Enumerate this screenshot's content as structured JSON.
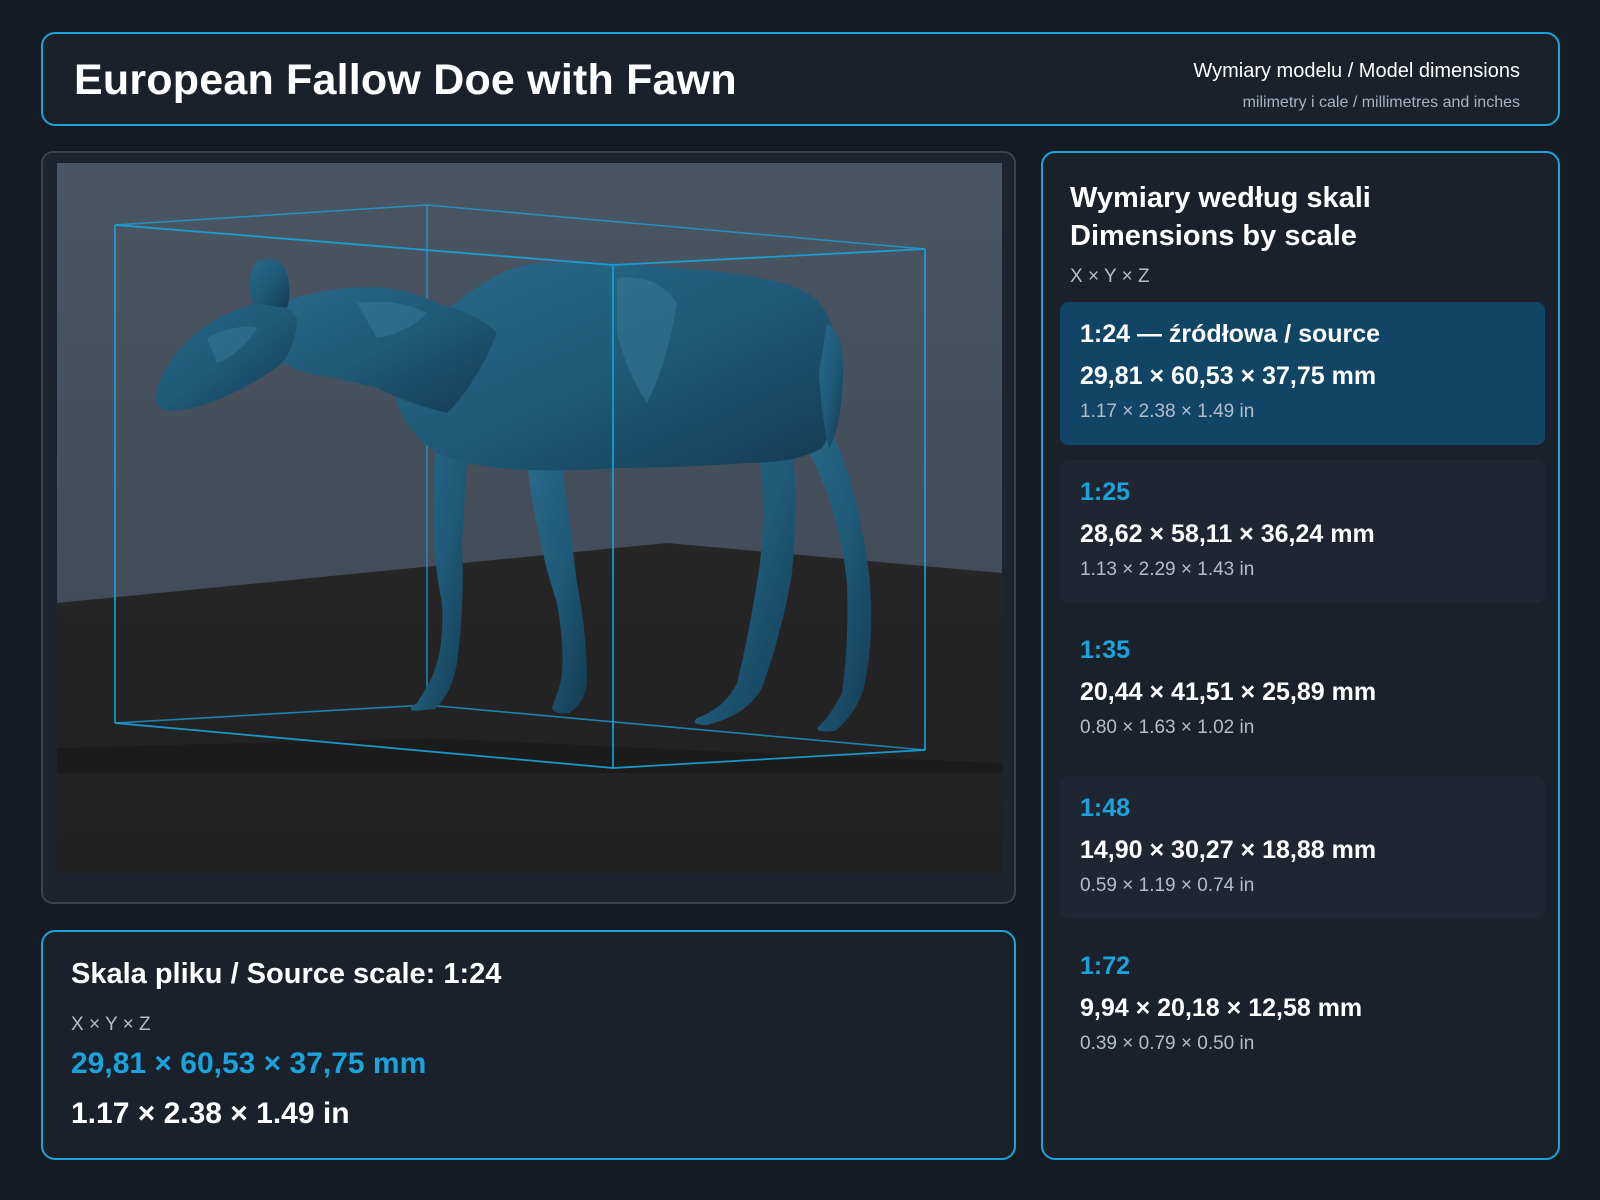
{
  "header": {
    "title": "European Fallow Doe with Fawn",
    "subtitle": "Wymiary modelu / Model dimensions",
    "units_note": "milimetry i cale / millimetres and inches"
  },
  "viewer": {
    "model_color": "#1f5a78",
    "bbox_color": "#1aa3dc"
  },
  "source": {
    "title": "Skala pliku / Source scale: 1:24",
    "axis_label": "X × Y × Z",
    "mm": "29,81 × 60,53 × 37,75 mm",
    "in": "1.17 × 2.38 × 1.49 in"
  },
  "scales": {
    "title_pl": "Wymiary według skali",
    "title_en": "Dimensions by scale",
    "axis_label": "X × Y × Z",
    "items": [
      {
        "label": "1:24  —  źródłowa / source",
        "mm": "29,81 × 60,53 × 37,75 mm",
        "in": "1.17 × 2.38 × 1.49 in",
        "selected": true
      },
      {
        "label": "1:25",
        "mm": "28,62 × 58,11 × 36,24 mm",
        "in": "1.13 × 2.29 × 1.43 in"
      },
      {
        "label": "1:35",
        "mm": "20,44 × 41,51 × 25,89 mm",
        "in": "0.80 × 1.63 × 1.02 in"
      },
      {
        "label": "1:48",
        "mm": "14,90 × 30,27 × 18,88 mm",
        "in": "0.59 × 1.19 × 0.74 in"
      },
      {
        "label": "1:72",
        "mm": "9,94 × 20,18 × 12,58 mm",
        "in": "0.39 × 0.79 × 0.50 in"
      }
    ]
  },
  "colors": {
    "accent": "#1aa3dc",
    "background": "#151b24",
    "panel": "#1a212b",
    "selected_row": "#114566"
  }
}
